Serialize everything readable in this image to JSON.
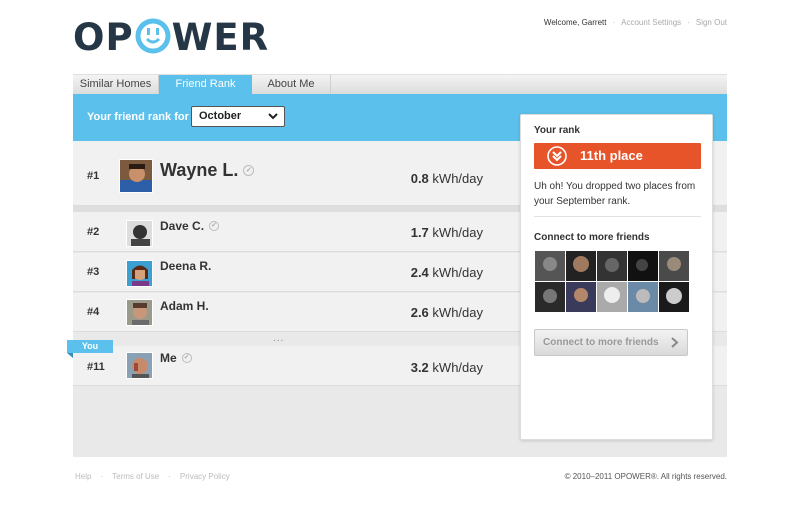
{
  "brand": {
    "logo_text_left": "OP",
    "logo_text_right": "WER",
    "accent": "#5bc0eb",
    "navy": "#253746",
    "orange": "#e8542a"
  },
  "topnav": {
    "welcome": "Welcome, Garrett",
    "separator": "·",
    "account_settings": "Account Settings",
    "sign_out": "Sign Out"
  },
  "tabs": [
    {
      "label": "Similar Homes",
      "active": false
    },
    {
      "label": "Friend Rank",
      "active": true
    },
    {
      "label": "About Me",
      "active": false
    }
  ],
  "header": {
    "rank_label": "Your friend rank for",
    "month": "October"
  },
  "ranking": [
    {
      "rank": "#1",
      "name": "Wayne L.",
      "value": "0.8",
      "unit": "kWh/day",
      "verified": true
    },
    {
      "rank": "#2",
      "name": "Dave C.",
      "value": "1.7",
      "unit": "kWh/day",
      "verified": true
    },
    {
      "rank": "#3",
      "name": "Deena R.",
      "value": "2.4",
      "unit": "kWh/day",
      "verified": false
    },
    {
      "rank": "#4",
      "name": "Adam H.",
      "value": "2.6",
      "unit": "kWh/day",
      "verified": false
    },
    {
      "rank": "#11",
      "name": "Me",
      "value": "3.2",
      "unit": "kWh/day",
      "verified": true
    }
  ],
  "ellipsis": "...",
  "you_flag": "You",
  "panel": {
    "your_rank_title": "Your rank",
    "place": "11th place",
    "message": "Uh oh! You dropped two places from your September rank.",
    "connect_title": "Connect to more friends",
    "connect_button": "Connect to more friends"
  },
  "footer": {
    "help": "Help",
    "terms": "Terms of Use",
    "privacy": "Privacy Policy",
    "separator": "·",
    "copyright": "© 2010–2011 OPOWER®. All rights reserved."
  }
}
